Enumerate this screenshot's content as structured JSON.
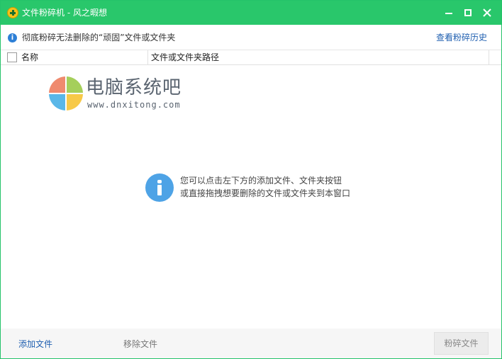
{
  "window": {
    "title": "文件粉碎机 - 风之暇想",
    "icon": "shredder-app-icon",
    "accent_color": "#29c76b"
  },
  "infobar": {
    "message": "彻底粉碎无法删除的“顽固”文件或文件夹",
    "history_link": "查看粉碎历史"
  },
  "table": {
    "columns": [
      "名称",
      "文件或文件夹路径"
    ],
    "rows": []
  },
  "watermark": {
    "title": "电脑系统吧",
    "url": "www.dnxitong.com"
  },
  "empty_hint": {
    "line1": "您可以点击左下方的添加文件、文件夹按钮",
    "line2": "或直接拖拽想要删除的文件或文件夹到本窗口"
  },
  "footer": {
    "add_file": "添加文件",
    "remove_file": "移除文件",
    "shred": "粉碎文件"
  }
}
